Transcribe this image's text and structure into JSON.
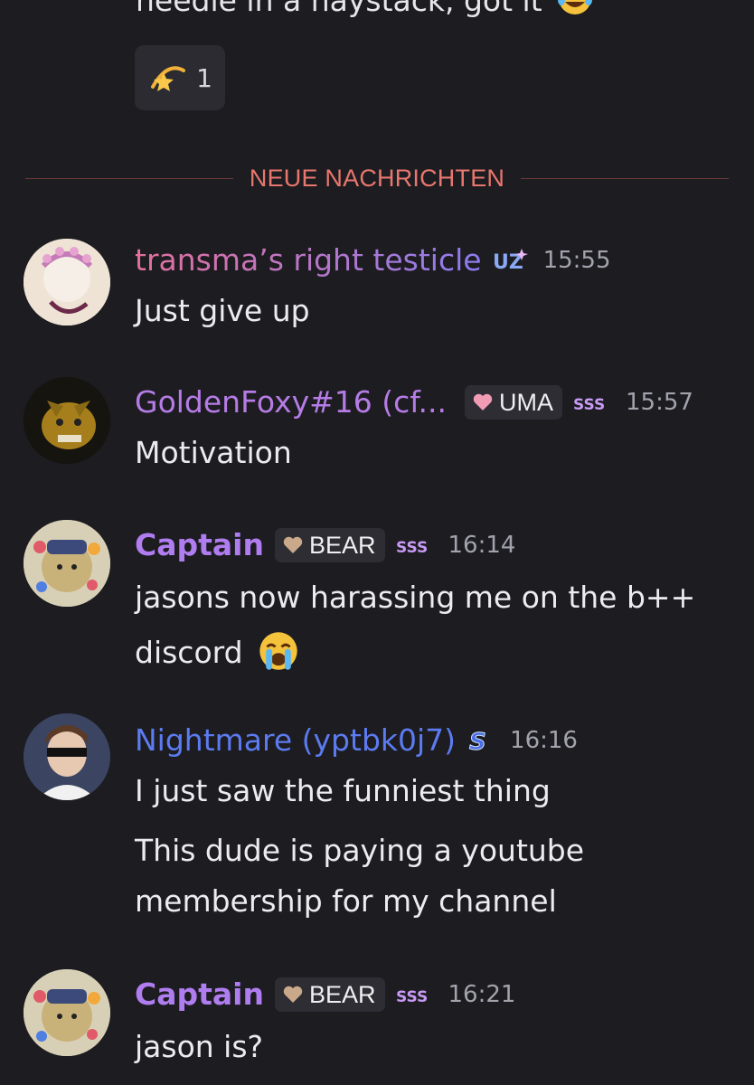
{
  "prev_message": {
    "tail": "needle in a haystack, got it",
    "emoji": "laughing-crying-emoji"
  },
  "reaction": {
    "icon": "shooting-star-emoji",
    "count": "1"
  },
  "divider": {
    "label": "NEUE NACHRICHTEN"
  },
  "colors": {
    "background": "#1c1c21",
    "divider": "#e8776e",
    "timestamp": "#a3a3ad",
    "tag_bg": "#2d2d33"
  },
  "messages": [
    {
      "name": "transma’s right testicle",
      "name_color_start": "#e3709c",
      "name_color_end": "#8d7cf0",
      "badge": "UZ",
      "time": "15:55",
      "lines": [
        "Just give up"
      ]
    },
    {
      "name": "GoldenFoxy#16 (cf...",
      "name_color": "#b67ce6",
      "tag": "UMA",
      "badge": "SSS",
      "time": "15:57",
      "lines": [
        "Motivation"
      ]
    },
    {
      "name": "Captain",
      "name_color": "#b07df0",
      "tag": "BEAR",
      "badge": "SSS",
      "time": "16:14",
      "lines": [
        "jasons now harassing me on the b++",
        "discord"
      ]
    },
    {
      "name": "Nightmare (yptbk0j7)",
      "name_color": "#5c7bf0",
      "badge": "S",
      "time": "16:16",
      "lines": [
        "I just saw the funniest thing",
        "This dude is paying a youtube",
        "membership for my channel"
      ]
    },
    {
      "name": "Captain",
      "name_color": "#b07df0",
      "tag": "BEAR",
      "badge": "SSS",
      "time": "16:21",
      "lines": [
        "jason is?"
      ]
    }
  ]
}
